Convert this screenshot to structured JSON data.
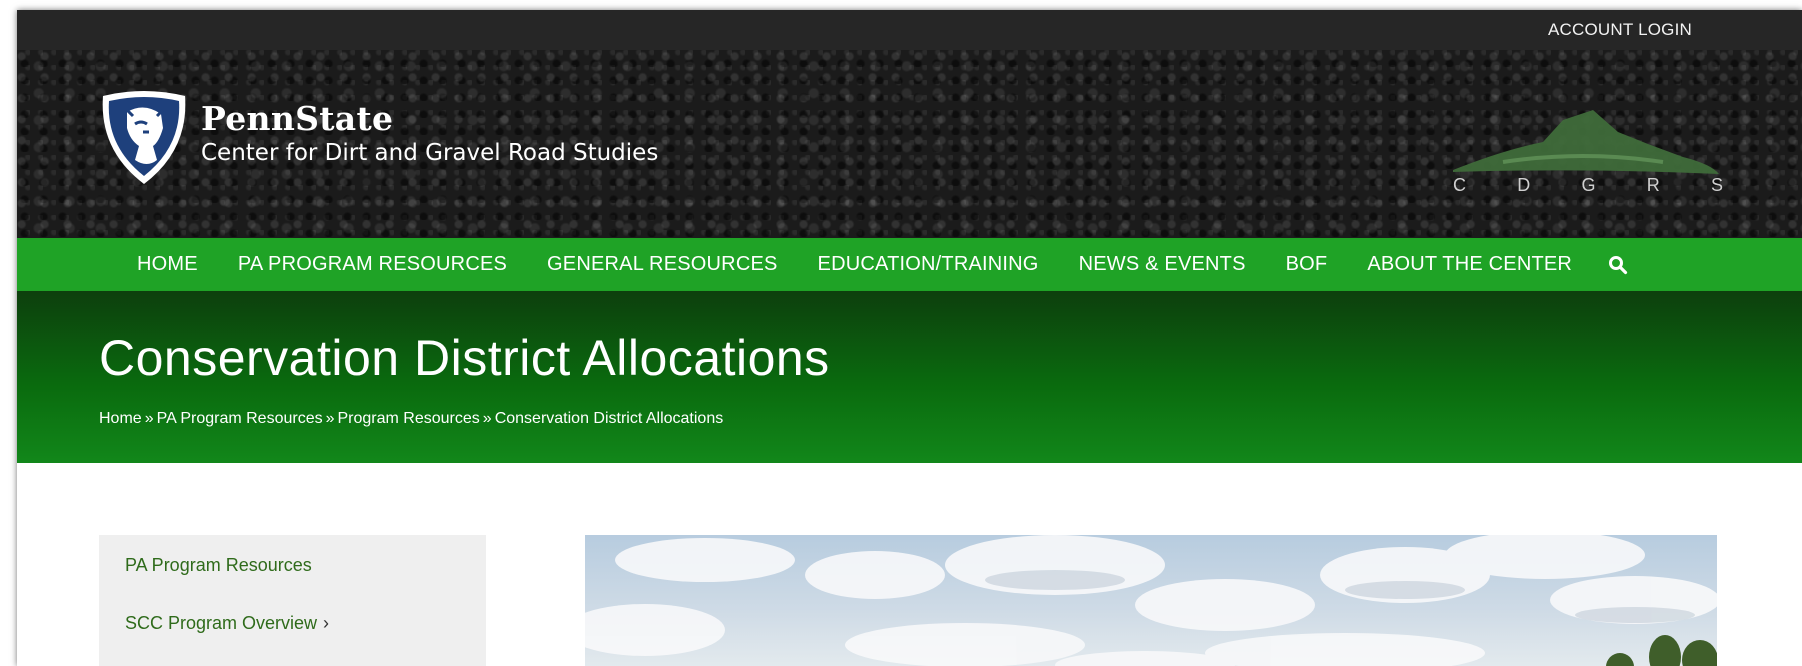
{
  "topbar": {
    "account_login": "ACCOUNT LOGIN"
  },
  "header": {
    "brand": "PennState",
    "subtitle": "Center for Dirt and Gravel Road Studies",
    "cdgrs_letters": [
      "C",
      "D",
      "G",
      "R",
      "S"
    ]
  },
  "nav": {
    "items": [
      {
        "label": "HOME"
      },
      {
        "label": "PA PROGRAM RESOURCES"
      },
      {
        "label": "GENERAL RESOURCES"
      },
      {
        "label": "EDUCATION/TRAINING"
      },
      {
        "label": "NEWS & EVENTS"
      },
      {
        "label": "BOF"
      },
      {
        "label": "ABOUT THE CENTER"
      }
    ],
    "search_icon": "search-icon"
  },
  "page": {
    "title": "Conservation District Allocations",
    "breadcrumb": [
      "Home",
      "PA Program Resources",
      "Program Resources",
      "Conservation District Allocations"
    ],
    "breadcrumb_separator": "»"
  },
  "sidebar": {
    "items": [
      {
        "label": "PA Program Resources"
      },
      {
        "label": "SCC Program Overview",
        "chevron": "›"
      }
    ]
  },
  "colors": {
    "nav_green": "#1fa326",
    "title_band_dark": "#0d3f0d",
    "title_band_light": "#12871a",
    "sidebar_link": "#2f6b1b",
    "topbar": "#262626"
  }
}
